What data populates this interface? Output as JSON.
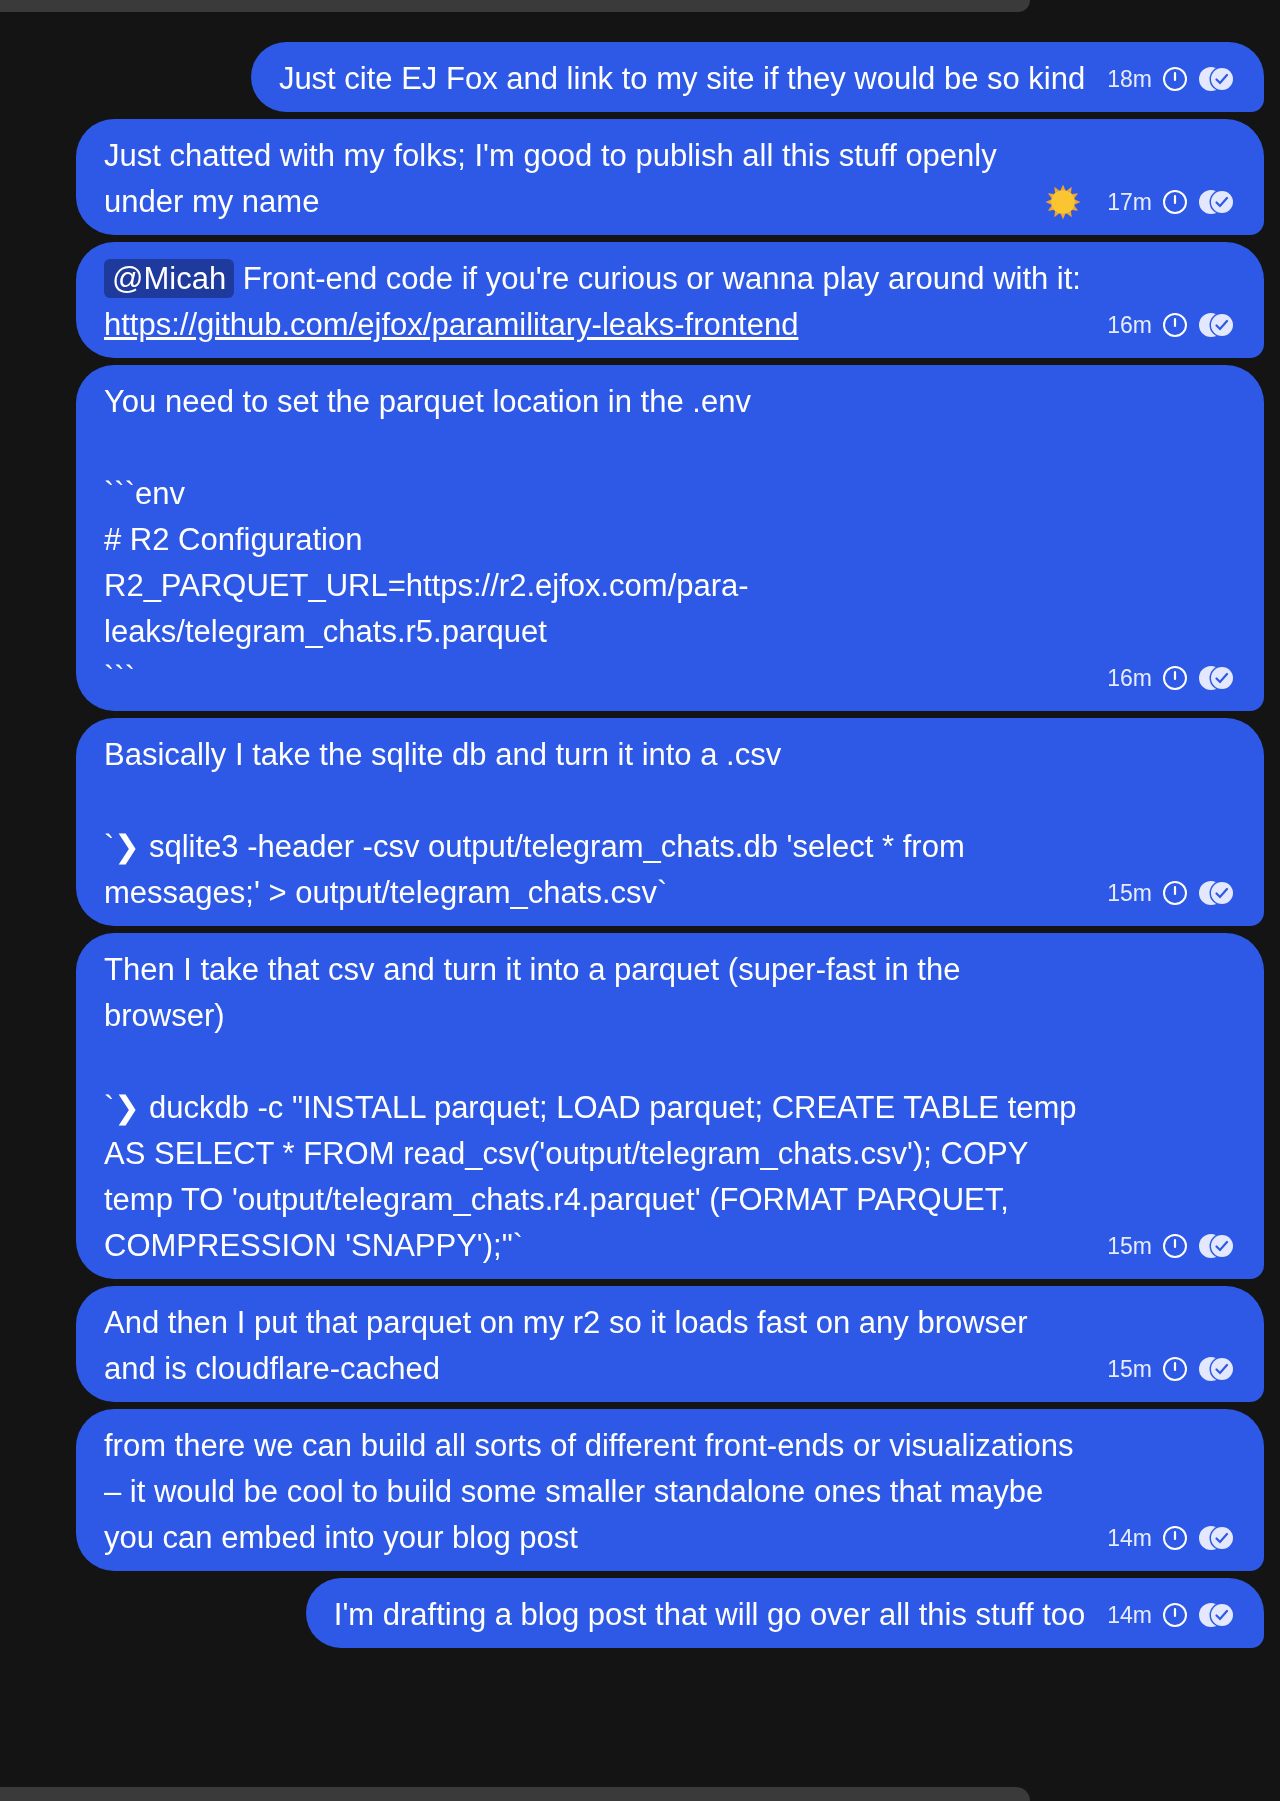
{
  "messages": [
    {
      "parts": [
        {
          "kind": "text",
          "text": "Just cite EJ Fox and link to my site if they would be so kind"
        }
      ],
      "time": "18m"
    },
    {
      "parts": [
        {
          "kind": "text",
          "text": "Just chatted with my folks; I'm good to publish all this stuff openly under my name"
        },
        {
          "kind": "sun"
        }
      ],
      "time": "17m"
    },
    {
      "parts": [
        {
          "kind": "mention",
          "text": "@Micah"
        },
        {
          "kind": "text",
          "text": " Front-end code if you're curious or wanna play around with it: "
        },
        {
          "kind": "link",
          "text": "https://github.com/ejfox/paramilitary-leaks-frontend"
        }
      ],
      "time": "16m"
    },
    {
      "parts": [
        {
          "kind": "text",
          "text": "You need to set the parquet location in the .env\n\n```env\n# R2 Configuration\nR2_PARQUET_URL=https://r2.ejfox.com/para-leaks/telegram_chats.r5.parquet\n```"
        }
      ],
      "time": "16m"
    },
    {
      "parts": [
        {
          "kind": "text",
          "text": "Basically I take the sqlite db and turn it into a .csv\n\n`❯ sqlite3 -header -csv output/telegram_chats.db 'select * from messages;' > output/telegram_chats.csv`"
        }
      ],
      "time": "15m"
    },
    {
      "parts": [
        {
          "kind": "text",
          "text": "Then I take that csv and turn it into a parquet (super-fast in the browser)\n\n`❯ duckdb -c \"INSTALL parquet; LOAD parquet; CREATE TABLE temp AS SELECT * FROM read_csv('output/telegram_chats.csv'); COPY temp TO 'output/telegram_chats.r4.parquet' (FORMAT PARQUET, COMPRESSION 'SNAPPY');\"`"
        }
      ],
      "time": "15m"
    },
    {
      "parts": [
        {
          "kind": "text",
          "text": "And then I put that parquet on my r2 so it loads fast on any browser and is cloudflare-cached"
        }
      ],
      "time": "15m"
    },
    {
      "parts": [
        {
          "kind": "text",
          "text": "from there we can build all sorts of different front-ends or visualizations – it would be cool to build some smaller standalone ones that maybe you can embed into your blog post"
        }
      ],
      "time": "14m"
    },
    {
      "parts": [
        {
          "kind": "text",
          "text": "I'm drafting a blog post that will go over all this stuff too"
        }
      ],
      "time": "14m"
    }
  ]
}
